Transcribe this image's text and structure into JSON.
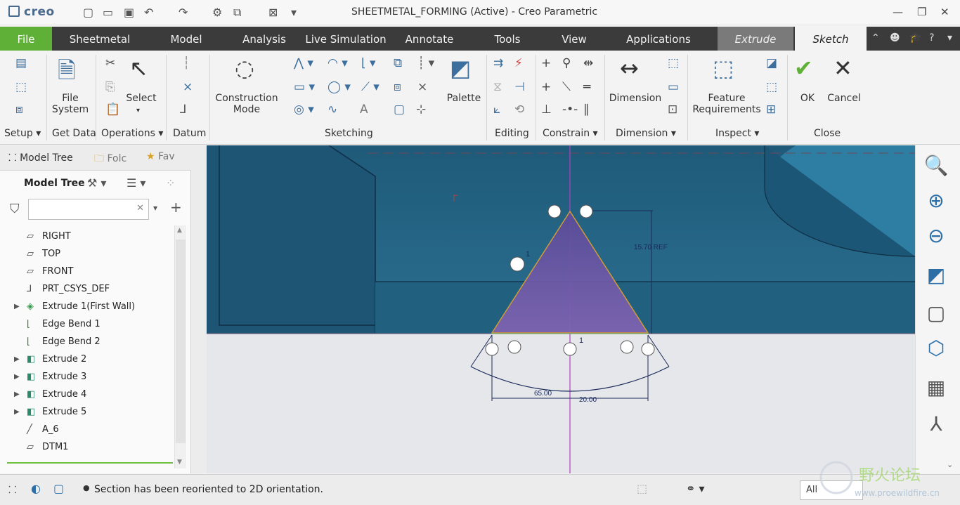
{
  "titlebar": {
    "logo": "creo",
    "title": "SHEETMETAL_FORMING (Active) - Creo Parametric"
  },
  "tabs": [
    "File",
    "Sheetmetal",
    "Model",
    "Analysis",
    "Live Simulation",
    "Annotate",
    "Tools",
    "View",
    "Applications",
    "Extrude",
    "Sketch"
  ],
  "ribbon": {
    "groups": {
      "setup": "Setup",
      "get_data": "Get Data",
      "operations": "Operations",
      "datum": "Datum",
      "sketching": "Sketching",
      "editing": "Editing",
      "constrain": "Constrain",
      "dimension": "Dimension",
      "inspect": "Inspect",
      "close": "Close"
    },
    "buttons": {
      "file_system": "File\nSystem",
      "select": "Select",
      "construction_mode": "Construction\nMode",
      "palette": "Palette",
      "dimension": "Dimension",
      "feature_requirements": "Feature\nRequirements",
      "ok": "OK",
      "cancel": "Cancel"
    }
  },
  "left_panel": {
    "tabs": [
      "Model Tree",
      "Folc",
      "Fav"
    ],
    "header": "Model Tree",
    "search_placeholder": "",
    "items": [
      {
        "label": "RIGHT",
        "icon": "datum-plane-icon",
        "expand": false
      },
      {
        "label": "TOP",
        "icon": "datum-plane-icon",
        "expand": false
      },
      {
        "label": "FRONT",
        "icon": "datum-plane-icon",
        "expand": false
      },
      {
        "label": "PRT_CSYS_DEF",
        "icon": "csys-icon",
        "expand": false
      },
      {
        "label": "Extrude 1(First Wall)",
        "icon": "extrude-wall-icon",
        "expand": true
      },
      {
        "label": "Edge Bend 1",
        "icon": "edge-bend-icon",
        "expand": false
      },
      {
        "label": "Edge Bend 2",
        "icon": "edge-bend-icon",
        "expand": false
      },
      {
        "label": "Extrude 2",
        "icon": "extrude-icon",
        "expand": true
      },
      {
        "label": "Extrude 3",
        "icon": "extrude-icon",
        "expand": true
      },
      {
        "label": "Extrude 4",
        "icon": "extrude-icon",
        "expand": true
      },
      {
        "label": "Extrude 5",
        "icon": "extrude-icon",
        "expand": true
      },
      {
        "label": "A_6",
        "icon": "datum-axis-icon",
        "expand": false
      },
      {
        "label": "DTM1",
        "icon": "datum-plane-icon",
        "expand": false
      }
    ]
  },
  "sketch": {
    "dim_height": "15.70 REF",
    "dim_width_a": "65.00",
    "dim_width_b": "20.00",
    "label_top": "1",
    "label_bottom": "1"
  },
  "status": {
    "message": "Section has been reoriented to 2D orientation.",
    "filter": "All"
  },
  "watermark": {
    "text": "野火论坛",
    "url": "www.proewildfire.cn"
  },
  "colors": {
    "accent_green": "#5fb036",
    "tab_bar": "#3b3b3b",
    "model_blue": "#215a7a",
    "sketch_fill": "#6a4f9e",
    "sketch_line": "#d99a2b"
  }
}
